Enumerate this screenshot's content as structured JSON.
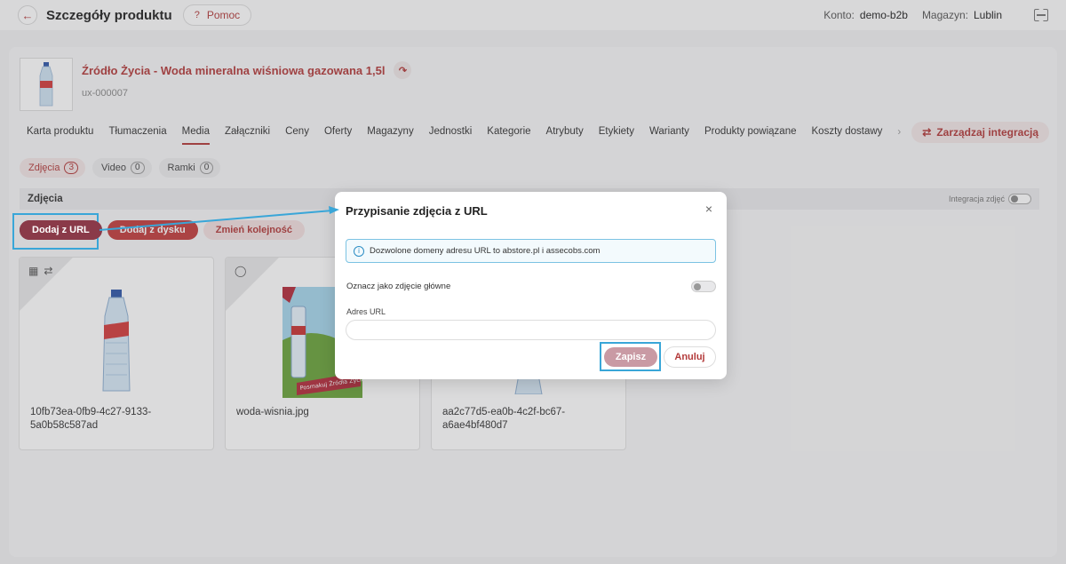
{
  "header": {
    "title": "Szczegóły produktu",
    "help_label": "Pomoc",
    "help_icon": "?",
    "account_label": "Konto:",
    "account_value": "demo-b2b",
    "warehouse_label": "Magazyn:",
    "warehouse_value": "Lublin"
  },
  "product": {
    "name": "Źródło Życia - Woda mineralna wiśniowa gazowana 1,5l",
    "code": "ux-000007"
  },
  "tabs": [
    {
      "label": "Karta produktu"
    },
    {
      "label": "Tłumaczenia"
    },
    {
      "label": "Media",
      "active": true
    },
    {
      "label": "Załączniki"
    },
    {
      "label": "Ceny"
    },
    {
      "label": "Oferty"
    },
    {
      "label": "Magazyny"
    },
    {
      "label": "Jednostki"
    },
    {
      "label": "Kategorie"
    },
    {
      "label": "Atrybuty"
    },
    {
      "label": "Etykiety"
    },
    {
      "label": "Warianty"
    },
    {
      "label": "Produkty powiązane"
    },
    {
      "label": "Koszty dostawy"
    }
  ],
  "tabs_more": "›",
  "integration_button": "Zarządzaj integracją",
  "subtabs": [
    {
      "label": "Zdjęcia",
      "count": "3"
    },
    {
      "label": "Video",
      "count": "0"
    },
    {
      "label": "Ramki",
      "count": "0"
    }
  ],
  "section": {
    "title": "Zdjęcia",
    "integration_label": "Integracja zdjęć"
  },
  "actions": {
    "add_url": "Dodaj z URL",
    "add_disk": "Dodaj z dysku",
    "reorder": "Zmień kolejność"
  },
  "tiles": [
    {
      "label": "10fb73ea-0fb9-4c27-9133-5a0b58c587ad"
    },
    {
      "label": "woda-wisnia.jpg"
    },
    {
      "label": "aa2c77d5-ea0b-4c2f-bc67-a6ae4bf480d7"
    }
  ],
  "poster_text": "Posmakuj Źródła Życia!",
  "modal": {
    "title": "Przypisanie zdjęcia z URL",
    "close": "×",
    "info": "Dozwolone domeny adresu URL to abstore.pl i assecobs.com",
    "main_label": "Oznacz jako zdjęcie główne",
    "main_checked": false,
    "url_label": "Adres URL",
    "url_value": "",
    "save": "Zapisz",
    "cancel": "Anuluj"
  },
  "colors": {
    "accent": "#b33a3a",
    "primary_button": "#8a3a49",
    "highlight": "#39a6d8"
  }
}
